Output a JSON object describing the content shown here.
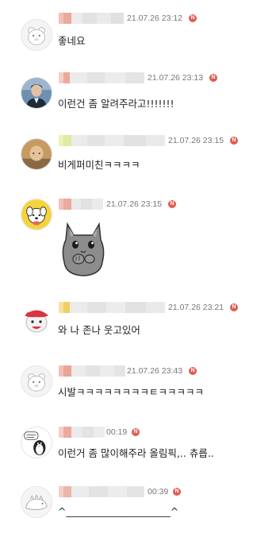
{
  "comments": [
    {
      "timestamp": "21.07.26 23:12",
      "badge": "N",
      "text": "좋네요",
      "avatar": "default-bear-avatar"
    },
    {
      "timestamp": "21.07.26 23:13",
      "badge": "N",
      "text": "이런건 좀 알려주라고!!!!!!!",
      "avatar": "profile-photo-avatar"
    },
    {
      "timestamp": "21.07.26 23:15",
      "badge": "N",
      "text": "비게퍼미친ㅋㅋㅋㅋ",
      "avatar": "profile-photo-avatar"
    },
    {
      "timestamp": "21.07.26 23:15",
      "badge": "N",
      "sticker": "gray-cat-sticker",
      "avatar": "yellow-dog-avatar"
    },
    {
      "timestamp": "21.07.26 23:21",
      "badge": "N",
      "text": "와 나 존나 웃고있어",
      "avatar": "red-character-avatar"
    },
    {
      "timestamp": "21.07.26 23:43",
      "badge": "N",
      "text": "시발ㅋㅋㅋㅋㅋㅋㅋㅋㅌㅋㅋㅋㅋㅋ",
      "avatar": "default-bear-avatar"
    },
    {
      "timestamp": "00:19",
      "badge": "N",
      "text": "이런거 좀 많이해주라 올림픽,.. 츄릅..",
      "avatar": "penguin-avatar"
    },
    {
      "timestamp": "00:39",
      "badge": "N",
      "text": "^_____________________^",
      "avatar": "dinosaur-avatar"
    }
  ]
}
